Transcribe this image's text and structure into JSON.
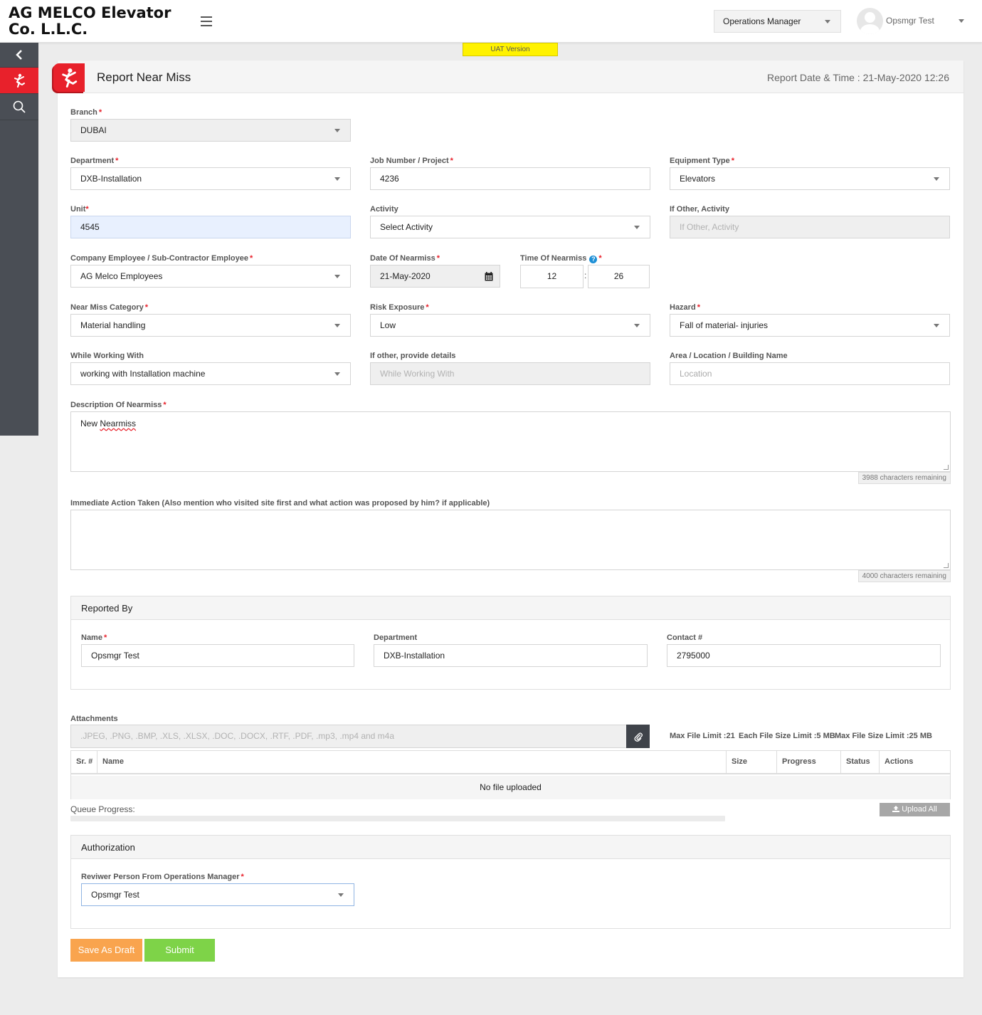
{
  "header": {
    "company_name": "AG MELCO Elevator Co. L.L.C.",
    "role_selected": "Operations Manager",
    "user_name": "Opsmgr Test"
  },
  "banner": {
    "uat_label": "UAT Version"
  },
  "sidebar": {
    "items": [
      {
        "icon": "chevron-left-icon"
      },
      {
        "icon": "near-miss-icon",
        "active": true
      },
      {
        "icon": "search-icon"
      }
    ]
  },
  "page": {
    "title": "Report Near Miss",
    "report_date_label": "Report Date & Time : 21-May-2020 12:26"
  },
  "form": {
    "branch": {
      "label": "Branch",
      "value": "DUBAI"
    },
    "department": {
      "label": "Department",
      "value": "DXB-Installation"
    },
    "job_number": {
      "label": "Job Number / Project",
      "value": "4236"
    },
    "equipment_type": {
      "label": "Equipment Type",
      "value": "Elevators"
    },
    "unit": {
      "label": "Unit",
      "value": "4545"
    },
    "activity": {
      "label": "Activity",
      "value": "Select Activity"
    },
    "other_activity": {
      "label": "If Other, Activity",
      "placeholder": "If Other, Activity"
    },
    "employee_type": {
      "label": "Company Employee / Sub-Contractor Employee",
      "value": "AG Melco Employees"
    },
    "date": {
      "label": "Date Of Nearmiss",
      "value": "21-May-2020"
    },
    "time": {
      "label": "Time Of Nearmiss",
      "help": "?",
      "hour": "12",
      "separator": ":",
      "minute": "26"
    },
    "category": {
      "label": "Near Miss Category",
      "value": "Material handling"
    },
    "risk": {
      "label": "Risk Exposure",
      "value": "Low"
    },
    "hazard": {
      "label": "Hazard",
      "value": "Fall of material- injuries"
    },
    "working_with": {
      "label": "While Working With",
      "value": "working with Installation machine"
    },
    "other_details": {
      "label": "If other, provide details",
      "placeholder": "While Working With"
    },
    "location": {
      "label": "Area / Location / Building Name",
      "placeholder": "Location"
    },
    "description": {
      "label": "Description Of Nearmiss",
      "value_prefix": "New ",
      "value_misspelled": "Nearmiss",
      "counter": "3988 characters remaining"
    },
    "action": {
      "label": "Immediate Action Taken (Also mention who visited site first and what action was proposed by him? if applicable)",
      "value": "",
      "counter": "4000 characters remaining"
    }
  },
  "reported_by": {
    "title": "Reported By",
    "name": {
      "label": "Name",
      "value": "Opsmgr Test"
    },
    "department": {
      "label": "Department",
      "value": "DXB-Installation"
    },
    "contact": {
      "label": "Contact #",
      "value": "2795000"
    }
  },
  "attachments": {
    "label": "Attachments",
    "types_placeholder": ".JPEG, .PNG, .BMP, .XLS, .XLSX, .DOC, .DOCX, .RTF, .PDF, .mp3, .mp4 and m4a",
    "limits": {
      "max_files": "Max File Limit :21",
      "each_size": "Each File Size Limit :5 MB",
      "max_size": "Max File Size Limit :25 MB"
    },
    "columns": [
      "Sr. #",
      "Name",
      "Size",
      "Progress",
      "Status",
      "Actions"
    ],
    "empty_text": "No file uploaded",
    "queue_label": "Queue Progress:",
    "queue_progress": 0,
    "upload_all_label": "Upload All"
  },
  "authorization": {
    "title": "Authorization",
    "reviewer_label": "Reviwer Person From Operations Manager",
    "reviewer_value": "Opsmgr Test"
  },
  "actions": {
    "draft_label": "Save As Draft",
    "submit_label": "Submit"
  },
  "colors": {
    "brand_red": "#e8212b",
    "sidebar": "#4a4e55",
    "draft": "#f9a44e",
    "submit": "#7ed348",
    "uat": "#fff200"
  }
}
